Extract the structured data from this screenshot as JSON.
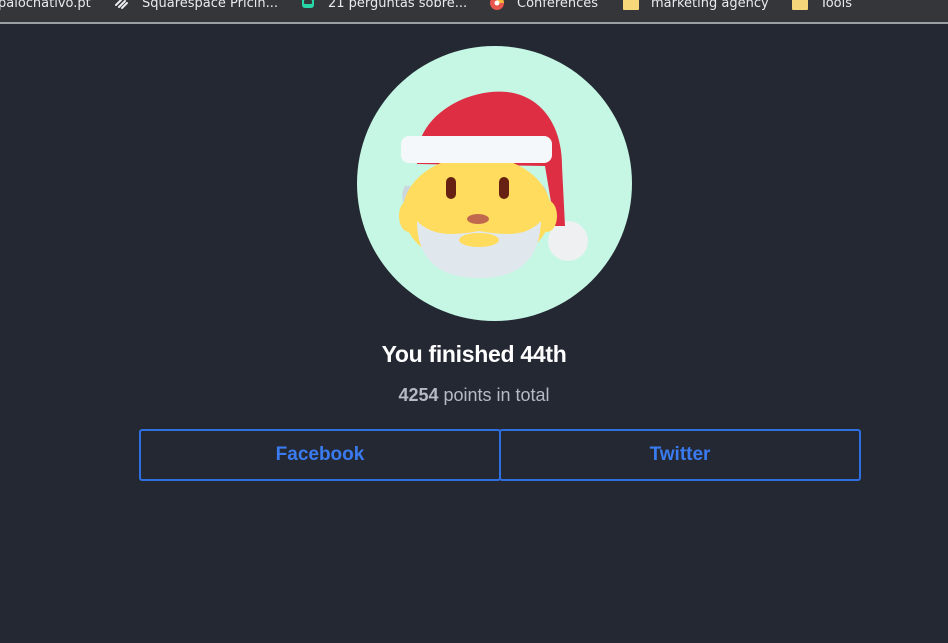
{
  "bookmarks": [
    {
      "label": "palochativo.pt",
      "icon": "none"
    },
    {
      "label": "Squarespace Pricin...",
      "icon": "squarespace-icon"
    },
    {
      "label": "21 perguntas sobre...",
      "icon": "bot-icon"
    },
    {
      "label": "Conferences",
      "icon": "conference-icon"
    },
    {
      "label": "marketing agency",
      "icon": "folder-icon"
    },
    {
      "label": "Tools",
      "icon": "folder-icon"
    }
  ],
  "result": {
    "headline": "You finished 44th",
    "points": "4254",
    "points_suffix": " points in total"
  },
  "share": {
    "facebook_label": "Facebook",
    "twitter_label": "Twitter"
  },
  "avatar": {
    "icon": "santa-claus-icon",
    "background": "#c6f7e5"
  },
  "colors": {
    "page_background": "#232833",
    "button_accent": "#2f6fe0"
  }
}
